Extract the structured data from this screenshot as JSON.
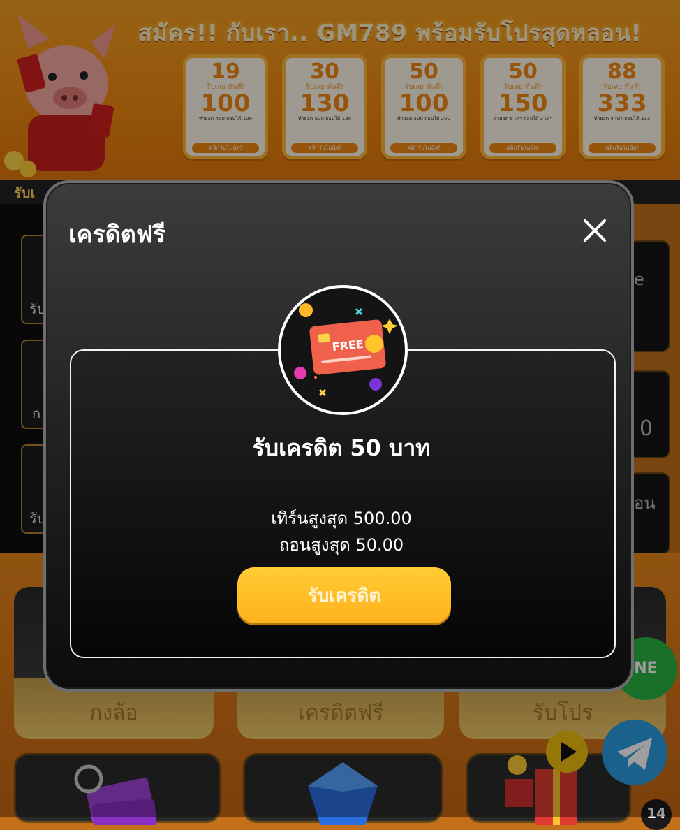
{
  "banner": {
    "headline": "สมัคร!! กับเรา.. GM789 พร้อมรับโปรสุดหลอน!",
    "promos": [
      {
        "deposit": "19",
        "sub": "รับเลย ทันที!",
        "get": "100",
        "note": "ทำยอด 450 ถอนได้ 100",
        "button": "คลิกรับโบนัส!"
      },
      {
        "deposit": "30",
        "sub": "รับเลย ทันที!",
        "get": "130",
        "note": "ทำยอด 500 ถอนได้ 130",
        "button": "คลิกรับโบนัส!"
      },
      {
        "deposit": "50",
        "sub": "รับเลย ทันที!",
        "get": "100",
        "note": "ทำยอด 500 ถอนได้ 200",
        "button": "คลิกรับโบนัส!"
      },
      {
        "deposit": "50",
        "sub": "รับเลย ทันที!",
        "get": "150",
        "note": "ทำยอด 6 เท่า ถอนได้ 3 เท่า",
        "button": "คลิกรับโบนัส!"
      },
      {
        "deposit": "88",
        "sub": "รับเลย ทันที!",
        "get": "333",
        "note": "ทำยอด 4 เท่า ถอนได้ 333",
        "button": "คลิกรับโบนัส!"
      }
    ]
  },
  "background": {
    "bar_text": "รับเ",
    "left_tiles": [
      "รับ",
      "ก",
      "รับ"
    ],
    "right_tiles": [
      "e",
      "0",
      "อน"
    ],
    "categories": [
      "กงล้อ",
      "เครดิตฟรี",
      "รับโปร"
    ],
    "line_label": "NE",
    "badge_count": "14"
  },
  "modal": {
    "title": "เครดิตฟรี",
    "card_label": "FREE",
    "credit_title": "รับเครดิต 50 บาท",
    "max_turnover": "เทิร์นสูงสุด 500.00",
    "max_withdraw": "ถอนสูงสุด 50.00",
    "claim_button": "รับเครดิต"
  },
  "colors": {
    "accent": "#ffbe2a",
    "modal_bg": "#1a1a1a",
    "banner": "#f08a12"
  }
}
